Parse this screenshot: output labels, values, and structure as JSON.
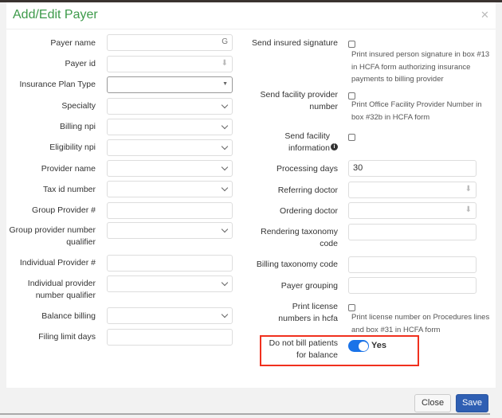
{
  "title": "Add/Edit Payer",
  "accent_color": "#3d9a4a",
  "left_fields": {
    "payer_name": "Payer name",
    "payer_id": "Payer id",
    "insurance_plan_type": "Insurance Plan Type",
    "specialty": "Specialty",
    "billing_npi": "Billing npi",
    "eligibility_npi": "Eligibility npi",
    "provider_name": "Provider name",
    "tax_id_number": "Tax id number",
    "group_provider": "Group Provider #",
    "group_provider_qualifier": "Group provider number qualifier",
    "individual_provider": "Individual Provider #",
    "individual_provider_qualifier": "Individual provider number qualifier",
    "balance_billing": "Balance billing",
    "filing_limit_days": "Filing limit days"
  },
  "right_fields": {
    "send_insured_signature": "Send insured signature",
    "send_insured_signature_help": "Print insured person signature in box #13 in HCFA form authorizing insurance payments to billing provider",
    "send_facility_provider_number": "Send facility provider number",
    "send_facility_provider_number_help": "Print Office Facility Provider Number in box #32b in HCFA form",
    "send_facility_information": "Send facility information",
    "processing_days": "Processing days",
    "processing_days_value": "30",
    "referring_doctor": "Referring doctor",
    "ordering_doctor": "Ordering doctor",
    "rendering_taxonomy_code": "Rendering taxonomy code",
    "billing_taxonomy_code": "Billing taxonomy code",
    "payer_grouping": "Payer grouping",
    "print_license_numbers": "Print license numbers in hcfa",
    "print_license_numbers_help": "Print license number on Procedures lines and box #31 in HCFA form",
    "do_not_bill": "Do not bill patients for balance",
    "do_not_bill_value": "Yes",
    "do_not_bill_on": true
  },
  "footer": {
    "close": "Close",
    "save": "Save"
  }
}
